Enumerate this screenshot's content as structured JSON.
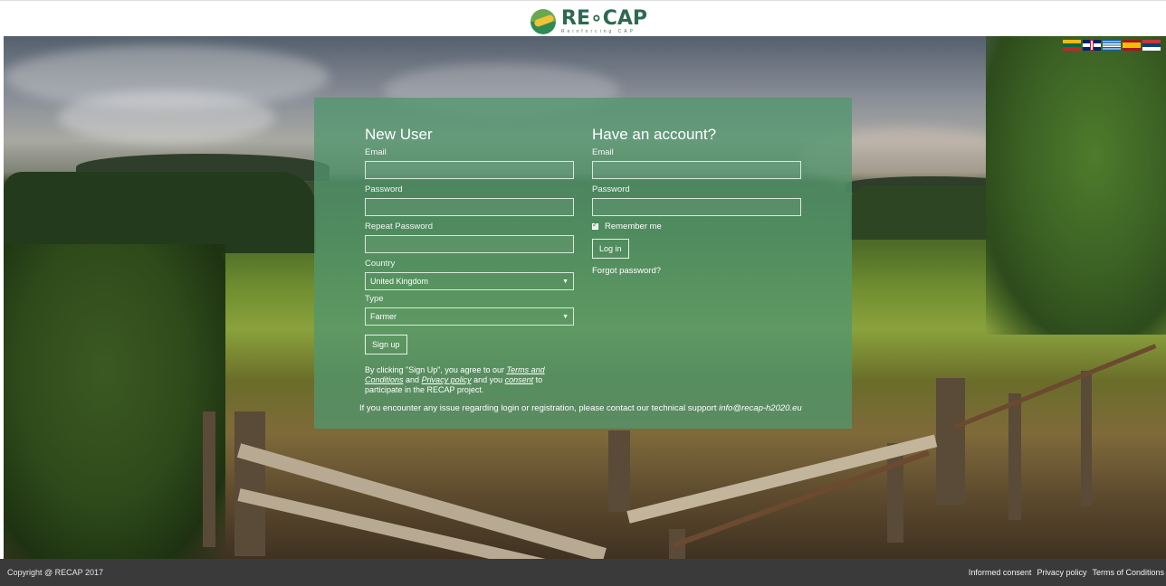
{
  "header": {
    "logo_name": "RE∘CAP",
    "logo_tagline": "Reinforcing CAP"
  },
  "languages": [
    "lt",
    "en",
    "gr",
    "es",
    "rs"
  ],
  "new_user": {
    "title": "New User",
    "email_label": "Email",
    "email_value": "",
    "password_label": "Password",
    "password_value": "",
    "repeat_password_label": "Repeat Password",
    "repeat_password_value": "",
    "country_label": "Country",
    "country_value": "United Kingdom",
    "type_label": "Type",
    "type_value": "Farmer",
    "signup_label": "Sign up",
    "legal_prefix": "By clicking \"Sign Up\", you agree to our ",
    "terms_link": "Terms and Conditions",
    "legal_and": " and ",
    "privacy_link": "Privacy policy",
    "legal_and_you": " and you ",
    "consent_link": "consent",
    "legal_suffix": " to participate in the RECAP project."
  },
  "existing_user": {
    "title": "Have an account?",
    "email_label": "Email",
    "email_value": "",
    "password_label": "Password",
    "password_value": "",
    "remember_label": "Remember me",
    "remember_checked": true,
    "login_label": "Log in",
    "forgot_label": "Forgot password?"
  },
  "support": {
    "text": "If you encounter any issue regarding login or registration, please contact our technical support ",
    "email": "info@recap-h2020.eu"
  },
  "footer": {
    "copyright": "Copyright @ RECAP 2017",
    "links": [
      "Informed consent",
      "Privacy policy",
      "Terms of Conditions"
    ]
  }
}
